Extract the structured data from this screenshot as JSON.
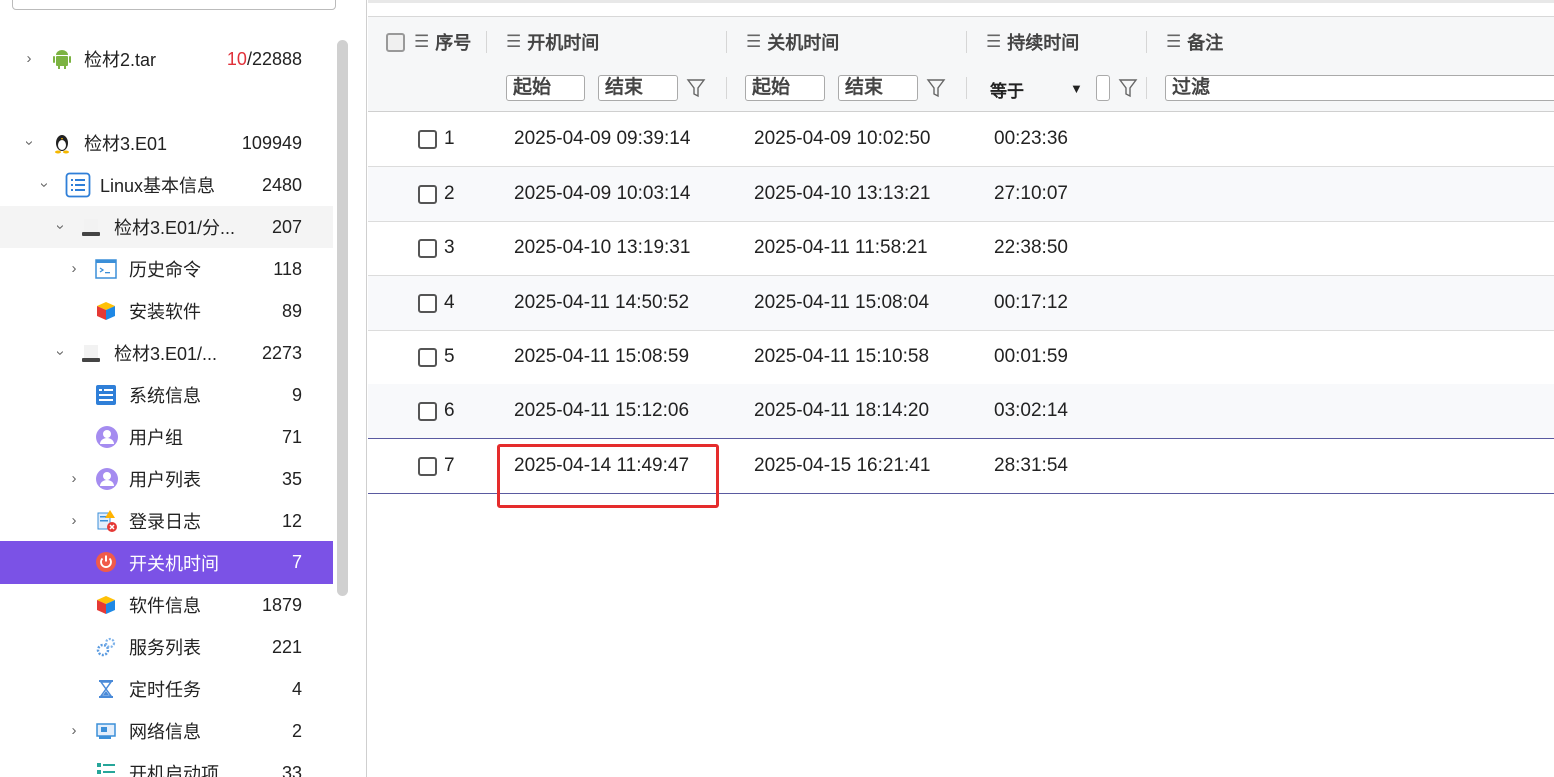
{
  "sidebar": {
    "items": [
      {
        "label": "检材2.tar",
        "count_red": "10",
        "count_rest": "/22888",
        "icon": "android-icon",
        "expanded": false
      },
      {
        "label": "检材3.E01",
        "count": "109949",
        "icon": "linux-penguin-icon",
        "expanded": true
      },
      {
        "label": "Linux基本信息",
        "count": "2480",
        "icon": "list-icon",
        "expanded": true
      },
      {
        "label": "检材3.E01/分...",
        "count": "207",
        "icon": "disk-icon",
        "expanded": true
      },
      {
        "label": "历史命令",
        "count": "118",
        "icon": "terminal-icon",
        "expanded": false
      },
      {
        "label": "安装软件",
        "count": "89",
        "icon": "cube-icon"
      },
      {
        "label": "检材3.E01/...",
        "count": "2273",
        "icon": "disk-icon",
        "expanded": true
      },
      {
        "label": "系统信息",
        "count": "9",
        "icon": "system-info-icon"
      },
      {
        "label": "用户组",
        "count": "71",
        "icon": "user-icon"
      },
      {
        "label": "用户列表",
        "count": "35",
        "icon": "user-icon",
        "expanded": false
      },
      {
        "label": "登录日志",
        "count": "12",
        "icon": "login-log-icon",
        "expanded": false
      },
      {
        "label": "开关机时间",
        "count": "7",
        "icon": "power-icon",
        "selected": true
      },
      {
        "label": "软件信息",
        "count": "1879",
        "icon": "cube-icon"
      },
      {
        "label": "服务列表",
        "count": "221",
        "icon": "gears-icon"
      },
      {
        "label": "定时任务",
        "count": "4",
        "icon": "hourglass-icon"
      },
      {
        "label": "网络信息",
        "count": "2",
        "icon": "network-card-icon",
        "expanded": false
      },
      {
        "label": "开机启动项",
        "count": "33",
        "icon": "startup-list-icon"
      }
    ]
  },
  "table": {
    "headers": {
      "index": "序号",
      "boot": "开机时间",
      "shutdown": "关机时间",
      "duration": "持续时间",
      "note": "备注"
    },
    "filters": {
      "boot_start": "起始",
      "boot_end": "结束",
      "shutdown_start": "起始",
      "shutdown_end": "结束",
      "duration_op": "等于",
      "note_placeholder": "过滤"
    },
    "rows": [
      {
        "index": "1",
        "boot": "2025-04-09 09:39:14",
        "shutdown": "2025-04-09 10:02:50",
        "duration": "00:23:36"
      },
      {
        "index": "2",
        "boot": "2025-04-09 10:03:14",
        "shutdown": "2025-04-10 13:13:21",
        "duration": "27:10:07"
      },
      {
        "index": "3",
        "boot": "2025-04-10 13:19:31",
        "shutdown": "2025-04-11 11:58:21",
        "duration": "22:38:50"
      },
      {
        "index": "4",
        "boot": "2025-04-11 14:50:52",
        "shutdown": "2025-04-11 15:08:04",
        "duration": "00:17:12"
      },
      {
        "index": "5",
        "boot": "2025-04-11 15:08:59",
        "shutdown": "2025-04-11 15:10:58",
        "duration": "00:01:59"
      },
      {
        "index": "6",
        "boot": "2025-04-11 15:12:06",
        "shutdown": "2025-04-11 18:14:20",
        "duration": "03:02:14"
      },
      {
        "index": "7",
        "boot": "2025-04-14 11:49:47",
        "shutdown": "2025-04-15 16:21:41",
        "duration": "28:31:54"
      }
    ]
  },
  "colors": {
    "selected": "#7b52e6",
    "highlight_box": "#e52c2c",
    "count_red": "#e0313a"
  }
}
